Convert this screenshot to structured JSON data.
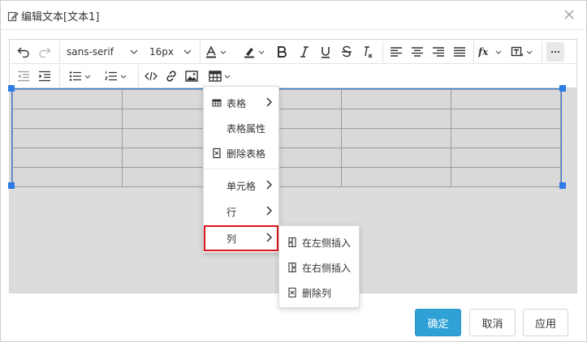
{
  "dialog": {
    "title": "编辑文本[文本1]",
    "close_icon": "close-icon"
  },
  "toolbar": {
    "font_family": "sans-serif",
    "font_size": "16px",
    "icons": [
      "undo-icon",
      "redo-icon",
      "font-color-icon",
      "highlight-icon",
      "bold-icon",
      "italic-icon",
      "underline-icon",
      "strikethrough-icon",
      "clear-format-icon",
      "align-left-icon",
      "align-center-icon",
      "align-right-icon",
      "align-justify-icon",
      "formula-icon",
      "insert-box-icon",
      "more-icon",
      "outdent-icon",
      "indent-icon",
      "bullet-list-icon",
      "numbered-list-icon",
      "code-icon",
      "link-icon",
      "image-icon",
      "table-icon"
    ]
  },
  "table": {
    "rows": 5,
    "cols": 5
  },
  "table_menu": {
    "items": [
      {
        "label": "表格"
      },
      {
        "label": "表格属性"
      },
      {
        "label": "删除表格"
      },
      {
        "label": "单元格"
      },
      {
        "label": "行"
      },
      {
        "label": "列"
      }
    ]
  },
  "column_submenu": {
    "items": [
      {
        "label": "在左侧插入"
      },
      {
        "label": "在右侧插入"
      },
      {
        "label": "删除列"
      }
    ]
  },
  "footer": {
    "confirm": "确定",
    "cancel": "取消",
    "apply": "应用"
  },
  "colors": {
    "primary": "#2fa1d6",
    "selection": "#2d7be5",
    "highlight_border": "#d9141b",
    "canvas": "#dcdcdc"
  }
}
